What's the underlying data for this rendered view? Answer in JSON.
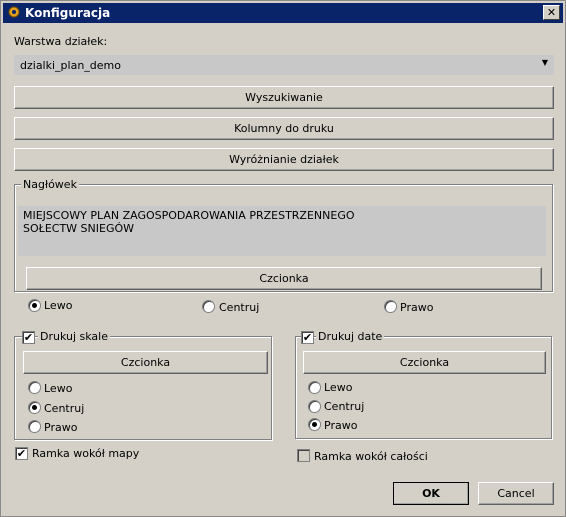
{
  "window": {
    "title": "Konfiguracja",
    "close": "✕"
  },
  "layer": {
    "label": "Warstwa działek:",
    "value": "dzialki_plan_demo",
    "arrow": "▼"
  },
  "buttons": {
    "search": "Wyszukiwanie",
    "columns": "Kolumny do druku",
    "highlight": "Wyróżnianie działek"
  },
  "header_group": {
    "legend": "Nagłówek",
    "line1": "MIEJSCOWY PLAN ZAGOSPODAROWANIA PRZESTRZENNEGO",
    "line2": "SOŁECTW SNIEGÓW",
    "font_button": "Czcionka",
    "align": {
      "left": "Lewo",
      "center": "Centruj",
      "right": "Prawo",
      "selected": "left"
    }
  },
  "scale_group": {
    "check_label": "Drukuj skale",
    "checked": true,
    "font_button": "Czcionka",
    "align": {
      "left": "Lewo",
      "center": "Centruj",
      "right": "Prawo",
      "selected": "center"
    }
  },
  "date_group": {
    "check_label": "Drukuj date",
    "checked": true,
    "font_button": "Czcionka",
    "align": {
      "left": "Lewo",
      "center": "Centruj",
      "right": "Prawo",
      "selected": "right"
    }
  },
  "frame_map": {
    "label": "Ramka wokół mapy",
    "checked": true
  },
  "frame_all": {
    "label": "Ramka wokół całości",
    "checked": false
  },
  "ok": "OK",
  "cancel": "Cancel",
  "check_mark": "✔"
}
